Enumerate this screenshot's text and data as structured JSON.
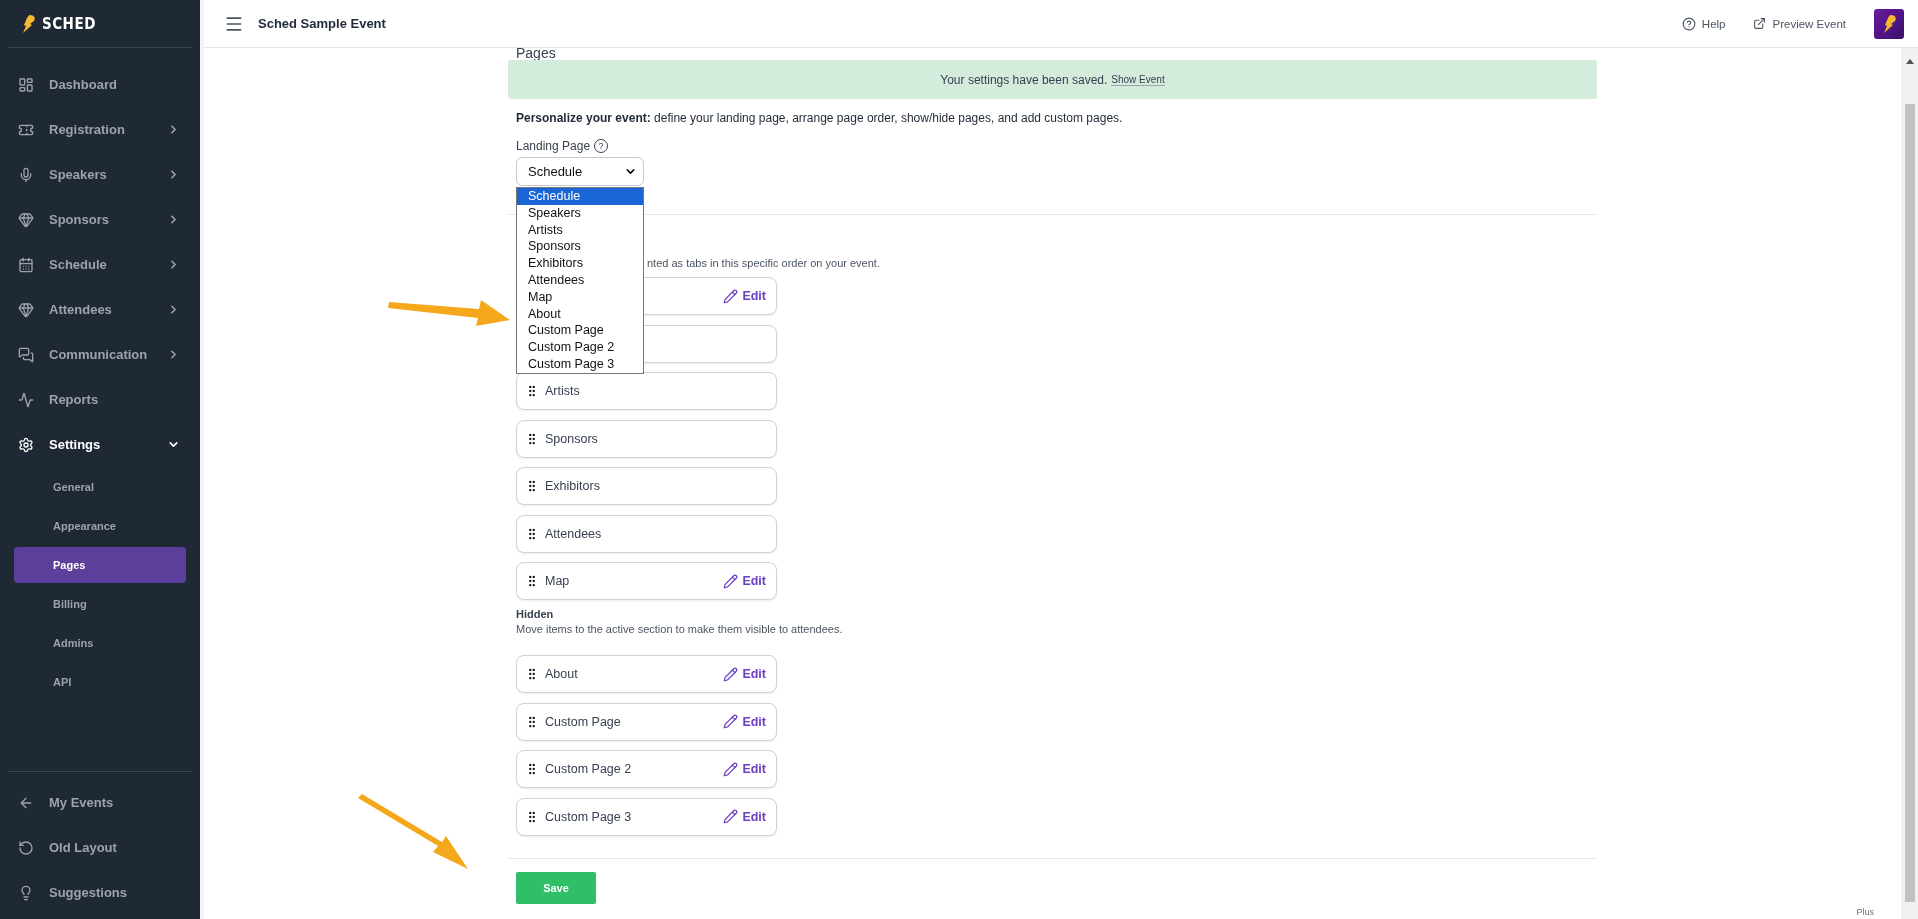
{
  "logo": {
    "text": "SCHED"
  },
  "sidebar": {
    "items": [
      {
        "label": "Dashboard",
        "kind": "link",
        "selected": false
      },
      {
        "label": "Registration",
        "kind": "collapsed",
        "selected": false
      },
      {
        "label": "Speakers",
        "kind": "collapsed",
        "selected": false
      },
      {
        "label": "Sponsors",
        "kind": "collapsed",
        "selected": false
      },
      {
        "label": "Schedule",
        "kind": "collapsed",
        "selected": false
      },
      {
        "label": "Attendees",
        "kind": "collapsed",
        "selected": false
      },
      {
        "label": "Communication",
        "kind": "collapsed",
        "selected": false
      },
      {
        "label": "Reports",
        "kind": "link",
        "selected": false
      },
      {
        "label": "Settings",
        "kind": "expanded",
        "selected": true,
        "children": [
          {
            "label": "General",
            "selected": false
          },
          {
            "label": "Appearance",
            "selected": false
          },
          {
            "label": "Pages",
            "selected": true
          },
          {
            "label": "Billing",
            "selected": false
          },
          {
            "label": "Admins",
            "selected": false
          },
          {
            "label": "API",
            "selected": false
          }
        ]
      }
    ],
    "footer": [
      {
        "label": "My Events"
      },
      {
        "label": "Old Layout"
      },
      {
        "label": "Suggestions"
      }
    ]
  },
  "header": {
    "title": "Sched Sample Event",
    "help": "Help",
    "preview": "Preview Event"
  },
  "content": {
    "title": "Pages",
    "notice": {
      "text": "Your settings have been saved.",
      "link": "Show Event"
    },
    "intro": "**Personalize your event:** define your landing page, arrange page order, show/hide pages, and add custom pages.",
    "landing": {
      "label": "Landing Page",
      "help": "?",
      "value": "Schedule",
      "options": [
        {
          "label": "Schedule",
          "selected": true
        },
        {
          "label": "Speakers",
          "selected": false
        },
        {
          "label": "Artists",
          "selected": false
        },
        {
          "label": "Sponsors",
          "selected": false
        },
        {
          "label": "Exhibitors",
          "selected": false
        },
        {
          "label": "Attendees",
          "selected": false
        },
        {
          "label": "Map",
          "selected": false
        },
        {
          "label": "About",
          "selected": false
        },
        {
          "label": "Custom Page",
          "selected": false
        },
        {
          "label": "Custom Page 2",
          "selected": false
        },
        {
          "label": "Custom Page 3",
          "selected": false
        }
      ]
    },
    "active": {
      "description": "nted as tabs in this specific order on your event.",
      "items": [
        {
          "kind": "covered",
          "edit": "Edit"
        },
        {
          "kind": "covered"
        },
        {
          "kind": "page",
          "label": "Artists"
        },
        {
          "kind": "page",
          "label": "Sponsors"
        },
        {
          "kind": "page",
          "label": "Exhibitors"
        },
        {
          "kind": "page",
          "label": "Attendees"
        },
        {
          "kind": "page",
          "label": "Map",
          "edit": "Edit"
        }
      ]
    },
    "hidden": {
      "title": "Hidden",
      "description": "Move items to the active section to make them visible to attendees.",
      "items": [
        {
          "kind": "page",
          "label": "About",
          "edit": "Edit"
        },
        {
          "kind": "page",
          "label": "Custom Page",
          "edit": "Edit"
        },
        {
          "kind": "page",
          "label": "Custom Page 2",
          "edit": "Edit"
        },
        {
          "kind": "page",
          "label": "Custom Page 3",
          "edit": "Edit"
        }
      ]
    },
    "save": "Save"
  },
  "plan": "Plus"
}
